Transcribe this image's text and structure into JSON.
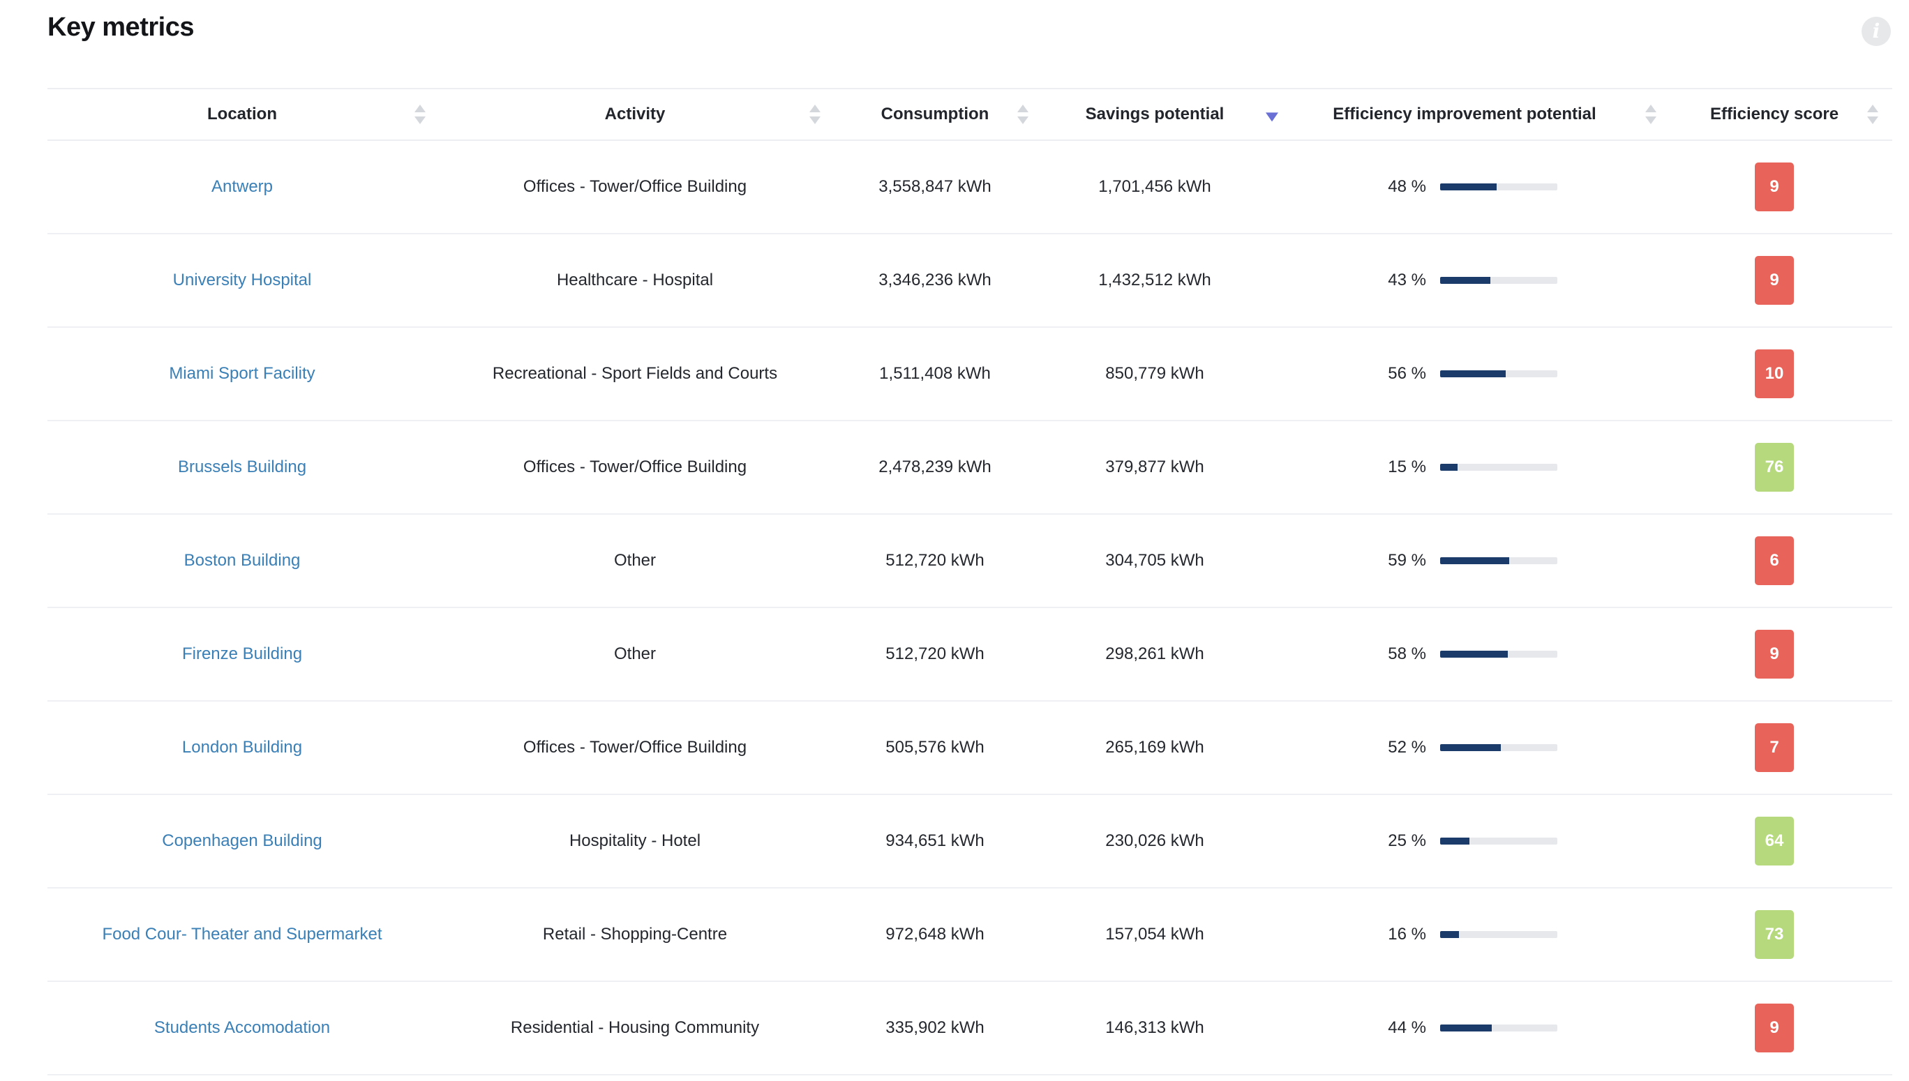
{
  "page": {
    "title": "Key metrics",
    "info_icon": "info-icon"
  },
  "colors": {
    "link": "#3a7fb6",
    "bar_fill": "#1b3b6b",
    "bar_track": "#e6e8ec",
    "score_low": "#e8645a",
    "score_high": "#b5d97c",
    "sort_active": "#6a6fd6"
  },
  "table": {
    "columns": [
      {
        "key": "location",
        "label": "Location",
        "sort": "none"
      },
      {
        "key": "activity",
        "label": "Activity",
        "sort": "none"
      },
      {
        "key": "consumption",
        "label": "Consumption",
        "sort": "none"
      },
      {
        "key": "savings",
        "label": "Savings potential",
        "sort": "desc"
      },
      {
        "key": "efficiency",
        "label": "Efficiency improvement potential",
        "sort": "none"
      },
      {
        "key": "score",
        "label": "Efficiency score",
        "sort": "none"
      }
    ],
    "rows": [
      {
        "location": "Antwerp",
        "activity": "Offices - Tower/Office Building",
        "consumption": "3,558,847 kWh",
        "savings": "1,701,456 kWh",
        "efficiency_pct": 48,
        "efficiency_label": "48 %",
        "score": "9",
        "score_level": "low"
      },
      {
        "location": "University Hospital",
        "activity": "Healthcare - Hospital",
        "consumption": "3,346,236 kWh",
        "savings": "1,432,512 kWh",
        "efficiency_pct": 43,
        "efficiency_label": "43 %",
        "score": "9",
        "score_level": "low"
      },
      {
        "location": "Miami Sport Facility",
        "activity": "Recreational - Sport Fields and Courts",
        "consumption": "1,511,408 kWh",
        "savings": "850,779 kWh",
        "efficiency_pct": 56,
        "efficiency_label": "56 %",
        "score": "10",
        "score_level": "low"
      },
      {
        "location": "Brussels Building",
        "activity": "Offices - Tower/Office Building",
        "consumption": "2,478,239 kWh",
        "savings": "379,877 kWh",
        "efficiency_pct": 15,
        "efficiency_label": "15 %",
        "score": "76",
        "score_level": "high"
      },
      {
        "location": "Boston Building",
        "activity": "Other",
        "consumption": "512,720 kWh",
        "savings": "304,705 kWh",
        "efficiency_pct": 59,
        "efficiency_label": "59 %",
        "score": "6",
        "score_level": "low"
      },
      {
        "location": "Firenze Building",
        "activity": "Other",
        "consumption": "512,720 kWh",
        "savings": "298,261 kWh",
        "efficiency_pct": 58,
        "efficiency_label": "58 %",
        "score": "9",
        "score_level": "low"
      },
      {
        "location": "London Building",
        "activity": "Offices - Tower/Office Building",
        "consumption": "505,576 kWh",
        "savings": "265,169 kWh",
        "efficiency_pct": 52,
        "efficiency_label": "52 %",
        "score": "7",
        "score_level": "low"
      },
      {
        "location": "Copenhagen Building",
        "activity": "Hospitality - Hotel",
        "consumption": "934,651 kWh",
        "savings": "230,026 kWh",
        "efficiency_pct": 25,
        "efficiency_label": "25 %",
        "score": "64",
        "score_level": "high"
      },
      {
        "location": "Food Cour- Theater and Supermarket",
        "activity": "Retail - Shopping-Centre",
        "consumption": "972,648 kWh",
        "savings": "157,054 kWh",
        "efficiency_pct": 16,
        "efficiency_label": "16 %",
        "score": "73",
        "score_level": "high"
      },
      {
        "location": "Students Accomodation",
        "activity": "Residential - Housing Community",
        "consumption": "335,902 kWh",
        "savings": "146,313 kWh",
        "efficiency_pct": 44,
        "efficiency_label": "44 %",
        "score": "9",
        "score_level": "low"
      }
    ]
  }
}
